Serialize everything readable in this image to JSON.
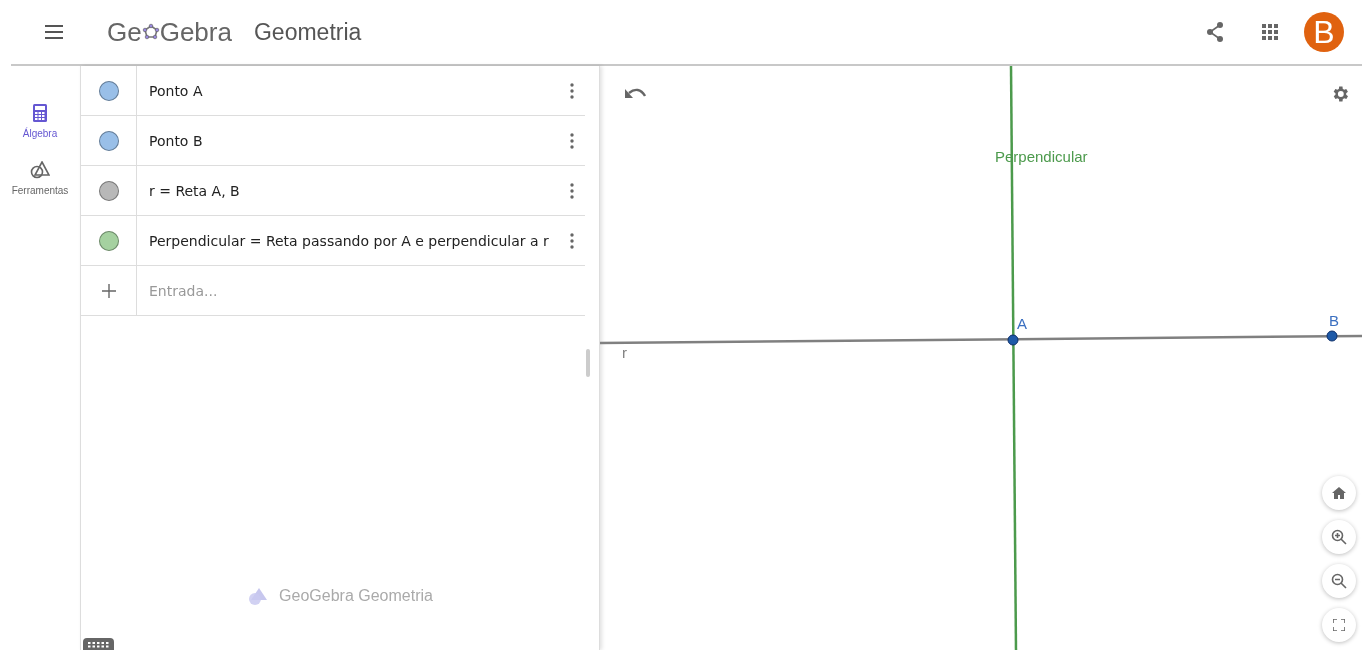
{
  "header": {
    "logo_parts": [
      "Ge",
      "Gebra"
    ],
    "app_name": "Geometria",
    "avatar": "B"
  },
  "sidebar": {
    "items": [
      {
        "label": "Álgebra",
        "kind": "calculator",
        "selected": true
      },
      {
        "label": "Ferramentas",
        "kind": "tools",
        "selected": false
      }
    ]
  },
  "algebra": {
    "rows": [
      {
        "text": "Ponto A",
        "color": "#99bfe8"
      },
      {
        "text": "Ponto B",
        "color": "#99bfe8"
      },
      {
        "text": "r = Reta A, B",
        "color": "#b8b8b8"
      },
      {
        "text": "Perpendicular = Reta passando por A e perpendicular a r",
        "color": "#a5d1a0"
      }
    ],
    "input": {
      "placeholder": "Entrada..."
    },
    "footer": "GeoGebra Geometria"
  },
  "graphics": {
    "lines": [
      {
        "label": "r",
        "color": "#808080"
      },
      {
        "label": "Perpendicular",
        "color": "#4c9a4c"
      }
    ],
    "points": [
      {
        "label": "A",
        "color": "#1e5aa8"
      },
      {
        "label": "B",
        "color": "#1e5aa8"
      }
    ]
  }
}
